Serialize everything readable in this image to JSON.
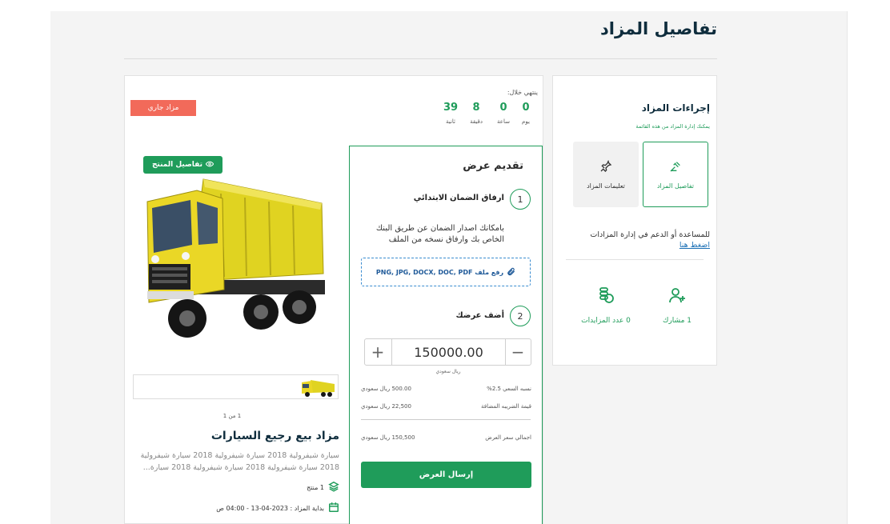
{
  "page": {
    "title": "تفاصيل المزاد"
  },
  "timer": {
    "label": "ينتهي خلال:",
    "days": "0",
    "days_label": "يوم",
    "hours": "0",
    "hours_label": "ساعة",
    "minutes": "8",
    "minutes_label": "دقيقة",
    "seconds": "39",
    "seconds_label": "ثانية"
  },
  "status_badge": "مزاد جاري",
  "offer": {
    "title": "تقديم عرض",
    "step1_num": "1",
    "step1_label": "ارفاق الضمان الابتدائي",
    "step1_desc": "بامكانك اصدار الضمان عن طريق البنك الخاص بك وارفاق نسخه من الملف",
    "upload_label": "رفع ملف PNG, JPG, DOCX, DOC, PDF",
    "step2_num": "2",
    "step2_label": "أضف عرضك",
    "amount": "150000.00",
    "plus": "+",
    "minus": "−",
    "currency": "ريال سعودي",
    "effort_label": "نسبه السعي 2.5%",
    "effort_value": "500.00 ريال سعودي",
    "vat_label": "قيمة الضريبه المضافة",
    "vat_value": "22,500 ريال سعودي",
    "total_label": "اجمالي سعر العرض",
    "total_value": "150,500 ريال سعودي",
    "submit_label": "إرسال العرض"
  },
  "product": {
    "details_button": "تفاصيل المنتج",
    "counter": "1 من 1",
    "title": "مزاد بيع رجيع السيارات",
    "description": "سيارة شيفرولية 2018 سيارة شيفرولية 2018 سيارة شيفرولية 2018 سيارة شيفرولية 2018 سيارة شيفرولية 2018 سيارة...",
    "product_count": "1 منتج",
    "start_date": "بداية المزاد : 2023-04-13 - 04:00 ص"
  },
  "sidebar": {
    "title": "إجراءات المزاد",
    "subtitle": "يمكنك إدارة المزاد من هذه القائمة",
    "card_details": "تفاصيل المزاد",
    "card_instructions": "تعليمات المزاد",
    "help_text": "للمساعدة أو الدعم في إدارة المزادات",
    "help_link": "اضغط هنا",
    "participants": "1 مشارك",
    "bids": "0 عدد المزايدات"
  },
  "colors": {
    "accent": "#1f9c5a",
    "status": "#f26a5a",
    "link": "#1a6fb5"
  }
}
